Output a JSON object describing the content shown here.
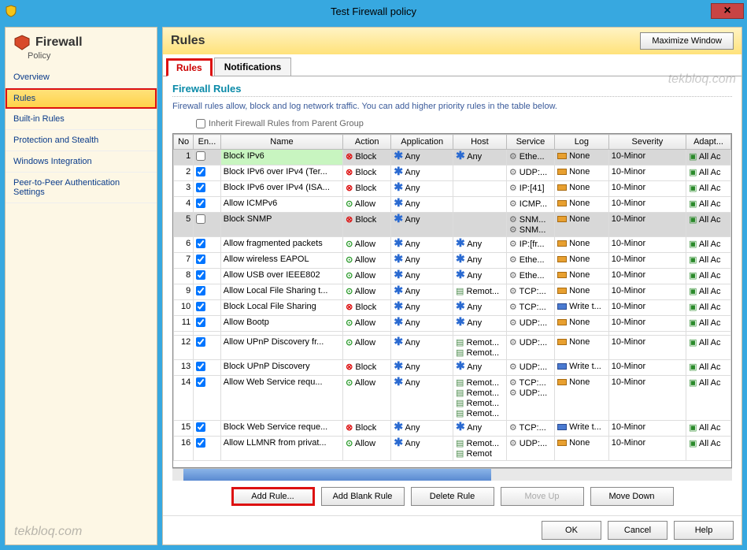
{
  "window": {
    "title": "Test Firewall policy",
    "close": "×"
  },
  "sidebar": {
    "title": "Firewall",
    "subtitle": "Policy",
    "items": [
      {
        "label": "Overview"
      },
      {
        "label": "Rules",
        "selected": true
      },
      {
        "label": "Built-in Rules"
      },
      {
        "label": "Protection and Stealth"
      },
      {
        "label": "Windows Integration"
      },
      {
        "label": "Peer-to-Peer Authentication Settings"
      }
    ]
  },
  "header": {
    "title": "Rules",
    "maximize": "Maximize Window"
  },
  "tabs": [
    {
      "label": "Rules",
      "active": true
    },
    {
      "label": "Notifications"
    }
  ],
  "section": {
    "subhead": "Firewall Rules",
    "desc": "Firewall rules allow, block and log network traffic. You can add higher priority rules in the table below.",
    "inherit": "Inherit Firewall Rules from Parent Group"
  },
  "columns": [
    "No",
    "En...",
    "Name",
    "Action",
    "Application",
    "Host",
    "Service",
    "Log",
    "Severity",
    "Adapt..."
  ],
  "rows": [
    {
      "no": "1",
      "enabled": false,
      "name": "Block IPv6",
      "action": "Block",
      "app": "Any",
      "host": "Any",
      "svc": "Ethe...",
      "log": "None",
      "sev": "10-Minor",
      "adapt": "All Ac",
      "sel": true,
      "green": true
    },
    {
      "no": "2",
      "enabled": true,
      "name": "Block IPv6 over IPv4 (Ter...",
      "action": "Block",
      "app": "Any",
      "host": "",
      "svc": "UDP:...",
      "log": "None",
      "sev": "10-Minor",
      "adapt": "All Ac"
    },
    {
      "no": "3",
      "enabled": true,
      "name": "Block IPv6 over IPv4 (ISA...",
      "action": "Block",
      "app": "Any",
      "host": "",
      "svc": "IP:[41]",
      "log": "None",
      "sev": "10-Minor",
      "adapt": "All Ac"
    },
    {
      "no": "4",
      "enabled": true,
      "name": "Allow ICMPv6",
      "action": "Allow",
      "app": "Any",
      "host": "",
      "svc": "ICMP...",
      "log": "None",
      "sev": "10-Minor",
      "adapt": "All Ac"
    },
    {
      "no": "5",
      "enabled": false,
      "name": "Block SNMP",
      "action": "Block",
      "app": "Any",
      "host": "",
      "svc": "SNM...",
      "svc2": "SNM...",
      "log": "None",
      "sev": "10-Minor",
      "adapt": "All Ac",
      "sel": true
    },
    {
      "no": "6",
      "enabled": true,
      "name": "Allow fragmented packets",
      "action": "Allow",
      "app": "Any",
      "host": "Any",
      "svc": "IP:[fr...",
      "log": "None",
      "sev": "10-Minor",
      "adapt": "All Ac"
    },
    {
      "no": "7",
      "enabled": true,
      "name": "Allow wireless EAPOL",
      "action": "Allow",
      "app": "Any",
      "host": "Any",
      "svc": "Ethe...",
      "log": "None",
      "sev": "10-Minor",
      "adapt": "All Ac"
    },
    {
      "no": "8",
      "enabled": true,
      "name": "Allow USB over IEEE802",
      "action": "Allow",
      "app": "Any",
      "host": "Any",
      "svc": "Ethe...",
      "log": "None",
      "sev": "10-Minor",
      "adapt": "All Ac"
    },
    {
      "no": "9",
      "enabled": true,
      "name": "Allow Local File Sharing t...",
      "action": "Allow",
      "app": "Any",
      "host": "Remot...",
      "svc": "TCP:...",
      "log": "None",
      "sev": "10-Minor",
      "adapt": "All Ac"
    },
    {
      "no": "10",
      "enabled": true,
      "name": "Block Local File Sharing",
      "action": "Block",
      "app": "Any",
      "host": "Any",
      "svc": "TCP:...",
      "log": "Write t...",
      "sev": "10-Minor",
      "adapt": "All Ac",
      "log2": true
    },
    {
      "no": "11",
      "enabled": true,
      "name": "Allow Bootp",
      "action": "Allow",
      "app": "Any",
      "host": "Any",
      "svc": "UDP:...",
      "log": "None",
      "sev": "10-Minor",
      "adapt": "All Ac"
    },
    {
      "no": "",
      "enabled": null,
      "name": "",
      "action": "",
      "app": "",
      "host": "",
      "svc": "",
      "log": "",
      "sev": "",
      "adapt": ""
    },
    {
      "no": "12",
      "enabled": true,
      "name": "Allow UPnP Discovery fr...",
      "action": "Allow",
      "app": "Any",
      "host": "Remot...",
      "host2": "Remot...",
      "svc": "UDP:...",
      "log": "None",
      "sev": "10-Minor",
      "adapt": "All Ac"
    },
    {
      "no": "13",
      "enabled": true,
      "name": "Block UPnP Discovery",
      "action": "Block",
      "app": "Any",
      "host": "Any",
      "svc": "UDP:...",
      "log": "Write t...",
      "sev": "10-Minor",
      "adapt": "All Ac",
      "log2": true
    },
    {
      "no": "14",
      "enabled": true,
      "name": "Allow Web Service requ...",
      "action": "Allow",
      "app": "Any",
      "host": "Remot...",
      "host2": "Remot...",
      "host3": "Remot...",
      "host4": "Remot...",
      "svc": "TCP:...",
      "svc2": "UDP:...",
      "log": "None",
      "sev": "10-Minor",
      "adapt": "All Ac"
    },
    {
      "no": "15",
      "enabled": true,
      "name": "Block Web Service reque...",
      "action": "Block",
      "app": "Any",
      "host": "Any",
      "svc": "TCP:...",
      "log": "Write t...",
      "sev": "10-Minor",
      "adapt": "All Ac",
      "log2": true
    },
    {
      "no": "16",
      "enabled": true,
      "name": "Allow LLMNR from privat...",
      "action": "Allow",
      "app": "Any",
      "host": "Remot...",
      "host2": "Remot",
      "svc": "UDP:...",
      "log": "None",
      "sev": "10-Minor",
      "adapt": "All Ac"
    }
  ],
  "buttons": {
    "add": "Add Rule...",
    "addblank": "Add Blank Rule",
    "delete": "Delete Rule",
    "moveup": "Move Up",
    "movedown": "Move Down"
  },
  "footer": {
    "ok": "OK",
    "cancel": "Cancel",
    "help": "Help"
  },
  "watermark": "tekbloq.com"
}
